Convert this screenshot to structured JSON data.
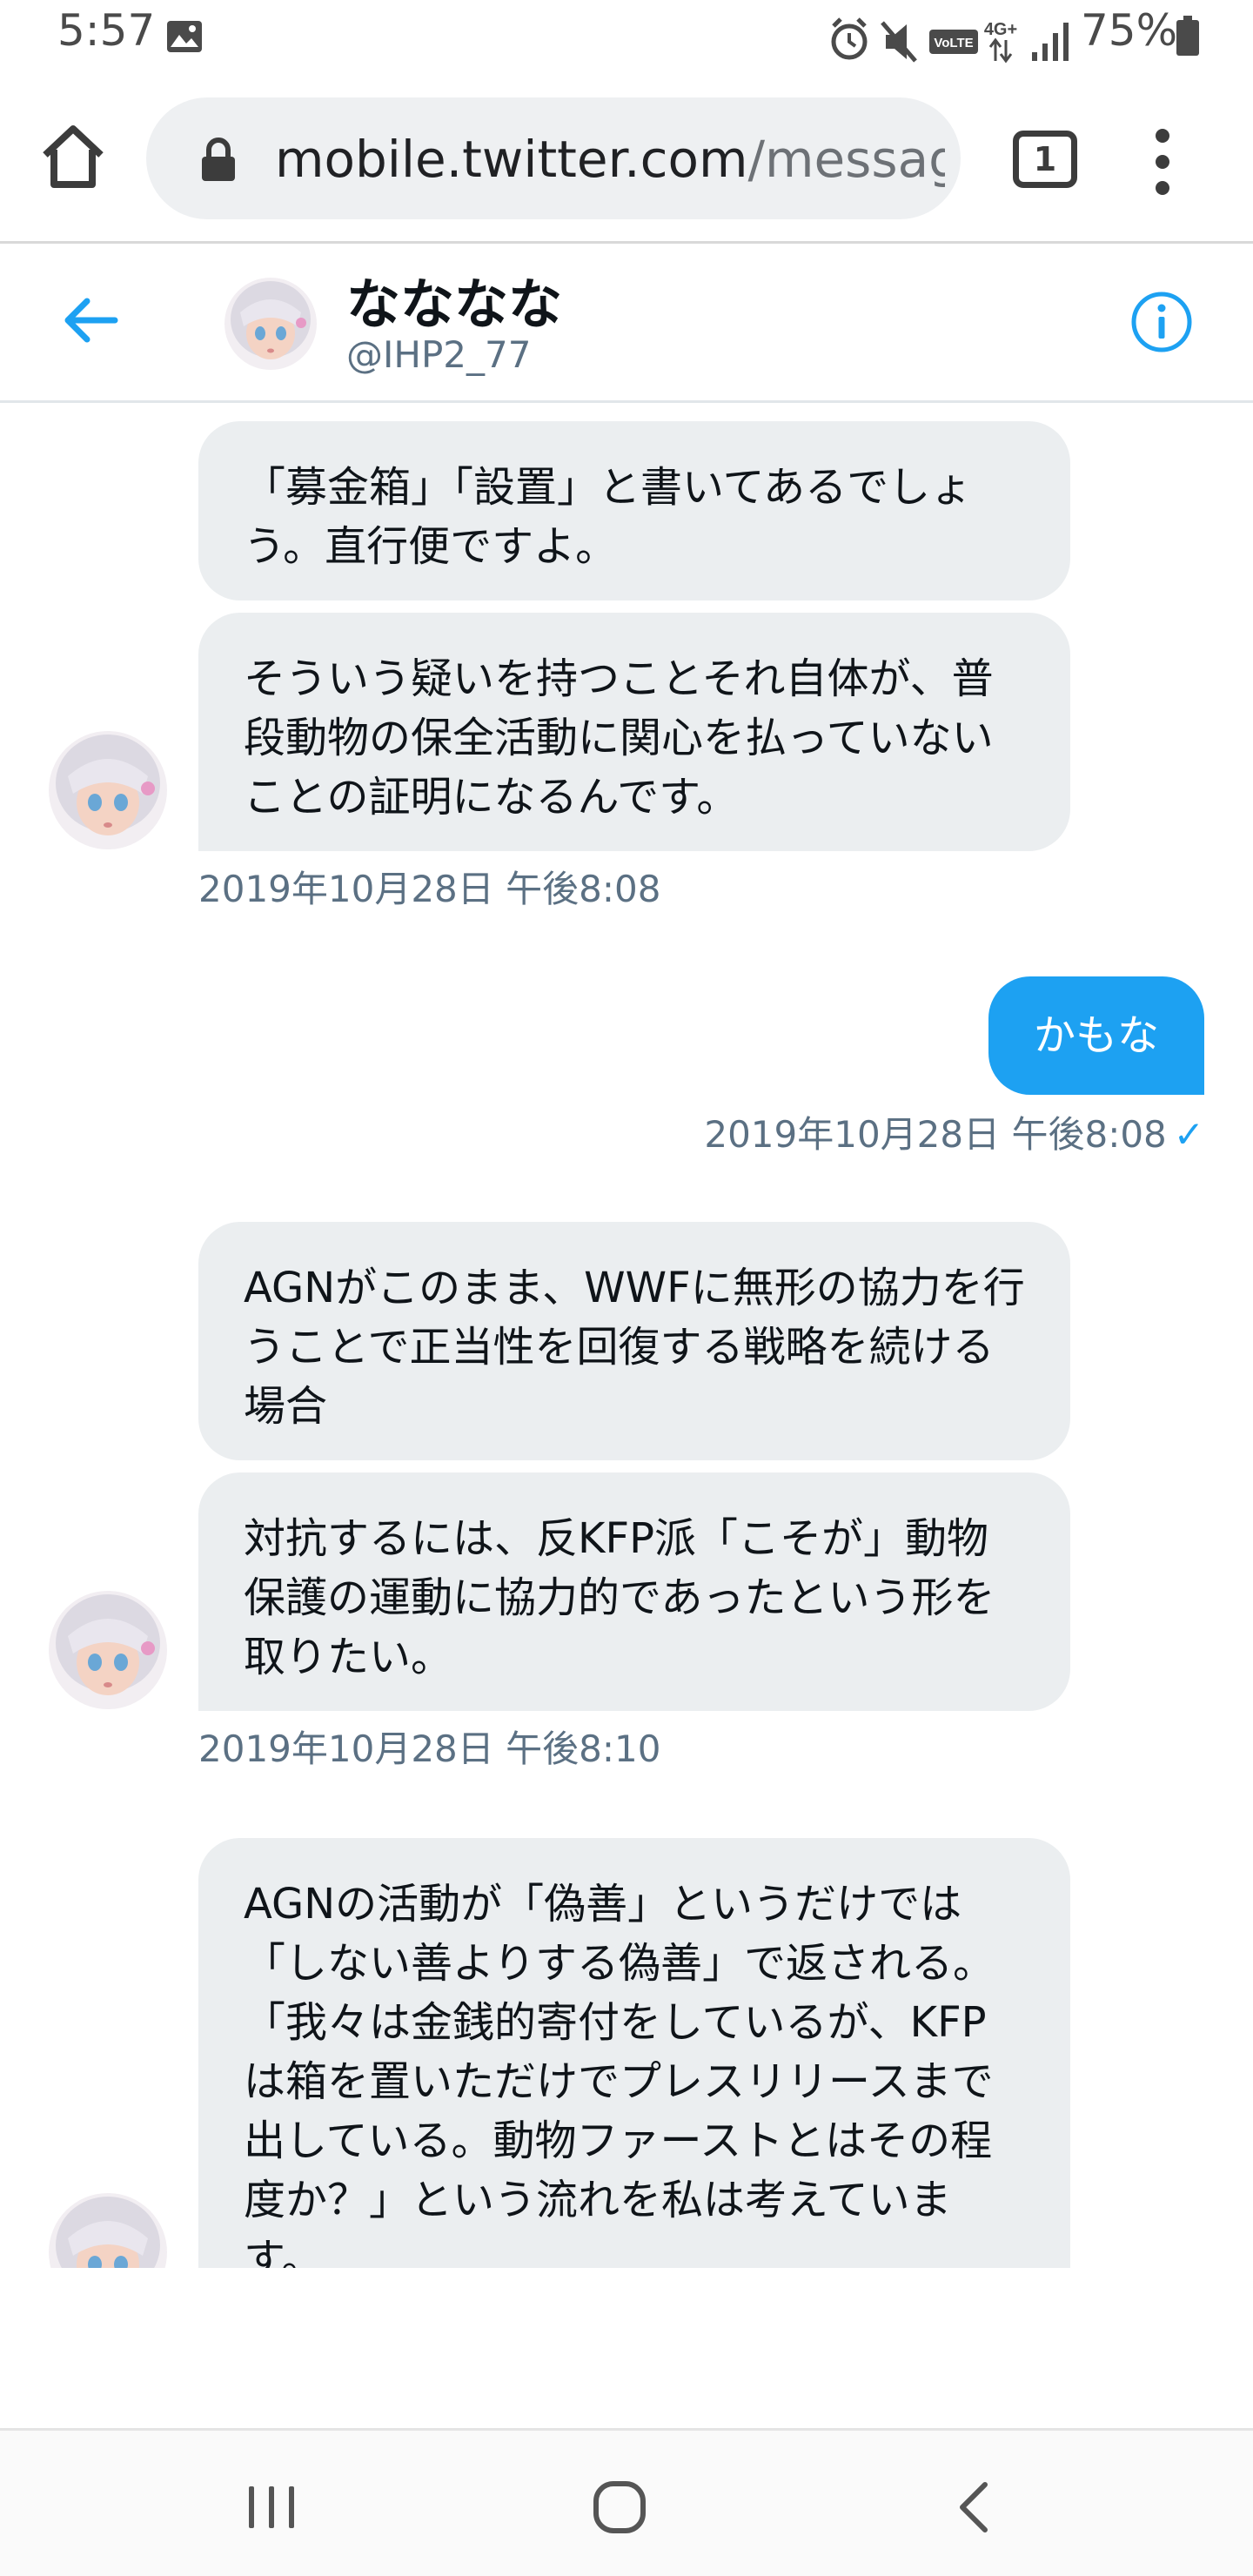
{
  "status_bar": {
    "time": "5:57",
    "battery": "75%",
    "icons": [
      "gallery-icon",
      "alarm-icon",
      "mute-icon",
      "volte-icon",
      "4g-icon",
      "signal-icon",
      "battery-icon"
    ],
    "volte_label": "VoLTE",
    "network_label": "4G+"
  },
  "browser": {
    "url_host": "mobile.twitter.com",
    "url_path": "/messag",
    "tab_count": "1"
  },
  "conversation": {
    "name": "なななな",
    "handle": "@IHP2_77"
  },
  "messages": [
    {
      "id": "m1",
      "direction": "in",
      "text": "「募金箱」「設置」と書いてあるでしょう。直行便ですよ。"
    },
    {
      "id": "m2",
      "direction": "in",
      "text": "そういう疑いを持つことそれ自体が、普段動物の保全活動に関心を払っていないことの証明になるんです。",
      "timestamp": "2019年10月28日 午後8:08"
    },
    {
      "id": "m3",
      "direction": "out",
      "text": "かもな",
      "timestamp": "2019年10月28日 午後8:08",
      "read_mark": "✓"
    },
    {
      "id": "m4",
      "direction": "in",
      "text": "AGNがこのまま、WWFに無形の協力を行うことで正当性を回復する戦略を続ける場合"
    },
    {
      "id": "m5",
      "direction": "in",
      "text": "対抗するには、反KFP派「こそが」動物保護の運動に協力的であったという形を取りたい。",
      "timestamp": "2019年10月28日 午後8:10"
    },
    {
      "id": "m6",
      "direction": "in",
      "text": "AGNの活動が「偽善」というだけでは「しない善よりする偽善」で返される。「我々は金銭的寄付をしているが、KFPは箱を置いただけでプレスリリースまで出している。動物ファーストとはその程度か？」という流れを私は考えています。"
    }
  ],
  "colors": {
    "accent": "#1da1f2",
    "bubble_in": "#ebeef0",
    "secondary_text": "#5b7083"
  }
}
